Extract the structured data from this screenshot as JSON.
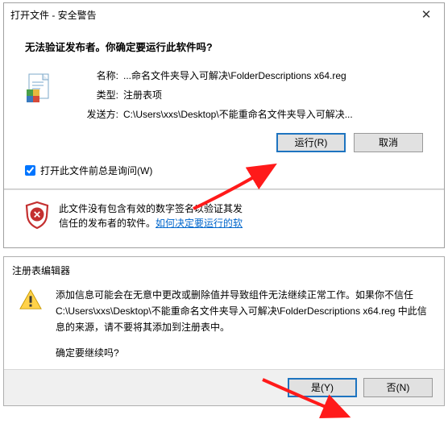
{
  "dialog1": {
    "title": "打开文件 - 安全警告",
    "heading": "无法验证发布者。你确定要运行此软件吗?",
    "name_label": "名称:",
    "name_value": "...命名文件夹导入可解决\\FolderDescriptions x64.reg",
    "type_label": "类型:",
    "type_value": "注册表项",
    "from_label": "发送方:",
    "from_value": "C:\\Users\\xxs\\Desktop\\不能重命名文件夹导入可解决...",
    "run_button": "运行(R)",
    "cancel_button": "取消",
    "checkbox_label": "打开此文件前总是询问(W)",
    "shield_text_1": "此文件没有包含有效的数字签名以验证其发",
    "shield_text_2": "信任的发布者的软件。",
    "shield_link": "如何决定要运行的软"
  },
  "dialog2": {
    "title": "注册表编辑器",
    "message_line1": "添加信息可能会在无意中更改或删除值并导致组件无法继续正常工作。如果你不信任 C:\\Users\\xxs\\Desktop\\不能重命名文件夹导入可解决\\FolderDescriptions x64.reg 中此信息的来源，请不要将其添加到注册表中。",
    "confirm": "确定要继续吗?",
    "yes_button": "是(Y)",
    "no_button": "否(N)"
  }
}
